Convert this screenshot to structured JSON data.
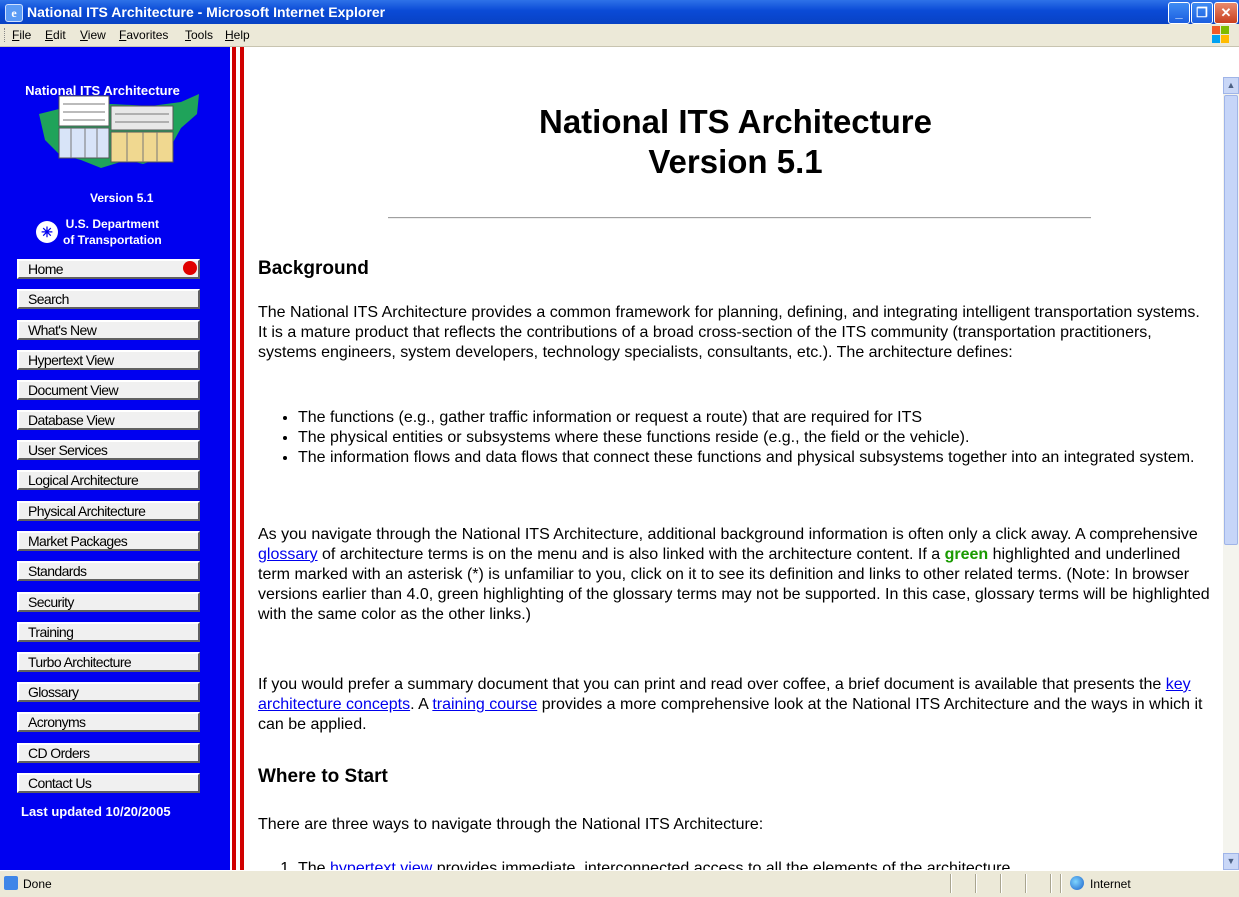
{
  "window": {
    "title": "National ITS Architecture - Microsoft Internet Explorer"
  },
  "menu": {
    "items": [
      "File",
      "Edit",
      "View",
      "Favorites",
      "Tools",
      "Help"
    ]
  },
  "sidebar": {
    "title": "National  ITS  Architecture",
    "version": "Version 5.1",
    "dot_line1": "U.S. Department",
    "dot_line2": "of Transportation",
    "items": [
      "Home",
      "Search",
      "What's New",
      "Hypertext View",
      "Document View",
      "Database View",
      "User Services",
      "Logical Architecture",
      "Physical Architecture",
      "Market Packages",
      "Standards",
      "Security",
      "Training",
      "Turbo Architecture",
      "Glossary",
      "Acronyms",
      "CD Orders",
      "Contact Us"
    ],
    "last_updated": "Last updated 10/20/2005"
  },
  "content": {
    "title_line1": "National ITS Architecture",
    "title_line2": "Version 5.1",
    "background_heading": "Background",
    "p1": "The National ITS Architecture provides a common framework for planning, defining, and integrating intelligent transportation systems.  It is a mature product that reflects the contributions of a broad cross-section of the ITS community (transportation practitioners, systems engineers, system developers, technology specialists, consultants, etc.). The architecture defines:",
    "bullets": [
      "The functions (e.g., gather traffic information or request a route) that are required for ITS",
      "The physical entities or subsystems where these functions reside (e.g., the field or the vehicle).",
      "The information flows and data flows that connect these functions and physical subsystems together into an integrated system."
    ],
    "p2_a": "As you navigate through the National ITS Architecture, additional background information is often only a click away.  A comprehensive ",
    "p2_link": "glossary",
    "p2_b": " of architecture terms is on the menu and is also linked with the architecture content.  If a ",
    "p2_green": "green",
    "p2_c": " highlighted and underlined term marked with an asterisk (*) is unfamiliar to you, click on it to see its definition and links to other related terms.  (Note: In browser versions earlier than 4.0, green highlighting of the glossary terms may not be supported.  In this case, glossary terms will be highlighted with the same color as the other links.)",
    "p3_a": "If you would prefer a summary document that you can print and read over coffee, a brief document is available that presents the ",
    "p3_link1": "key architecture concepts",
    "p3_b": ".  A ",
    "p3_link2": "training course",
    "p3_c": " provides a more comprehensive look at the National ITS Architecture and the ways in which it can be applied.",
    "start_heading": "Where to Start",
    "p4": "There are three ways to navigate through the National ITS Architecture:",
    "step1_a": "The ",
    "step1_link": "hypertext view",
    "step1_b": " provides immediate, interconnected access to all the elements of the architecture."
  },
  "status": {
    "text": "Done",
    "zone": "Internet"
  },
  "colors": {
    "nav_blue": "#0000f0",
    "stripe_red": "#d00000",
    "home_dot": "#e00000",
    "glossary_green": "#1a9a00"
  }
}
